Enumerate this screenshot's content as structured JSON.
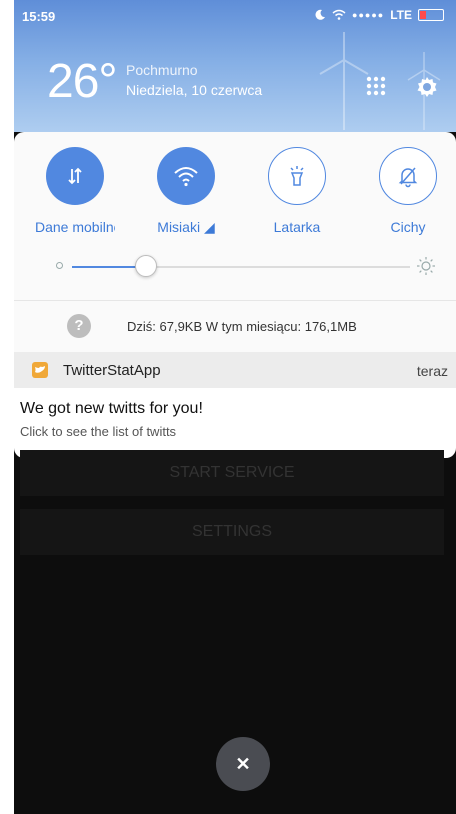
{
  "status_bar": {
    "time": "15:59",
    "carrier": "LTE",
    "signal": "●●●●●"
  },
  "weather": {
    "temperature": "26°",
    "condition": "Pochmurno",
    "date": "Niedziela, 10 czerwca"
  },
  "quick_settings": {
    "tiles": [
      {
        "label": "Dane mobilne",
        "state": "on",
        "icon": "mobile-data-icon"
      },
      {
        "label": "Misiaki ◢",
        "state": "on",
        "icon": "wifi-icon"
      },
      {
        "label": "Latarka",
        "state": "off",
        "icon": "flashlight-icon"
      },
      {
        "label": "Cichy",
        "state": "off",
        "icon": "silent-icon"
      }
    ],
    "brightness": 0.22,
    "data_usage": "Dziś: 67,9KB   W tym miesiącu: 176,1MB"
  },
  "notification": {
    "app_name": "TwitterStatApp",
    "time": "teraz",
    "title": "We got new twitts for you!",
    "text": "Click to see the list of twitts"
  },
  "app": {
    "start_label": "START SERVICE",
    "settings_label": "SETTINGS"
  },
  "close_symbol": "✕",
  "colors": {
    "accent": "#5188e0",
    "app_icon": "#f0a838"
  }
}
